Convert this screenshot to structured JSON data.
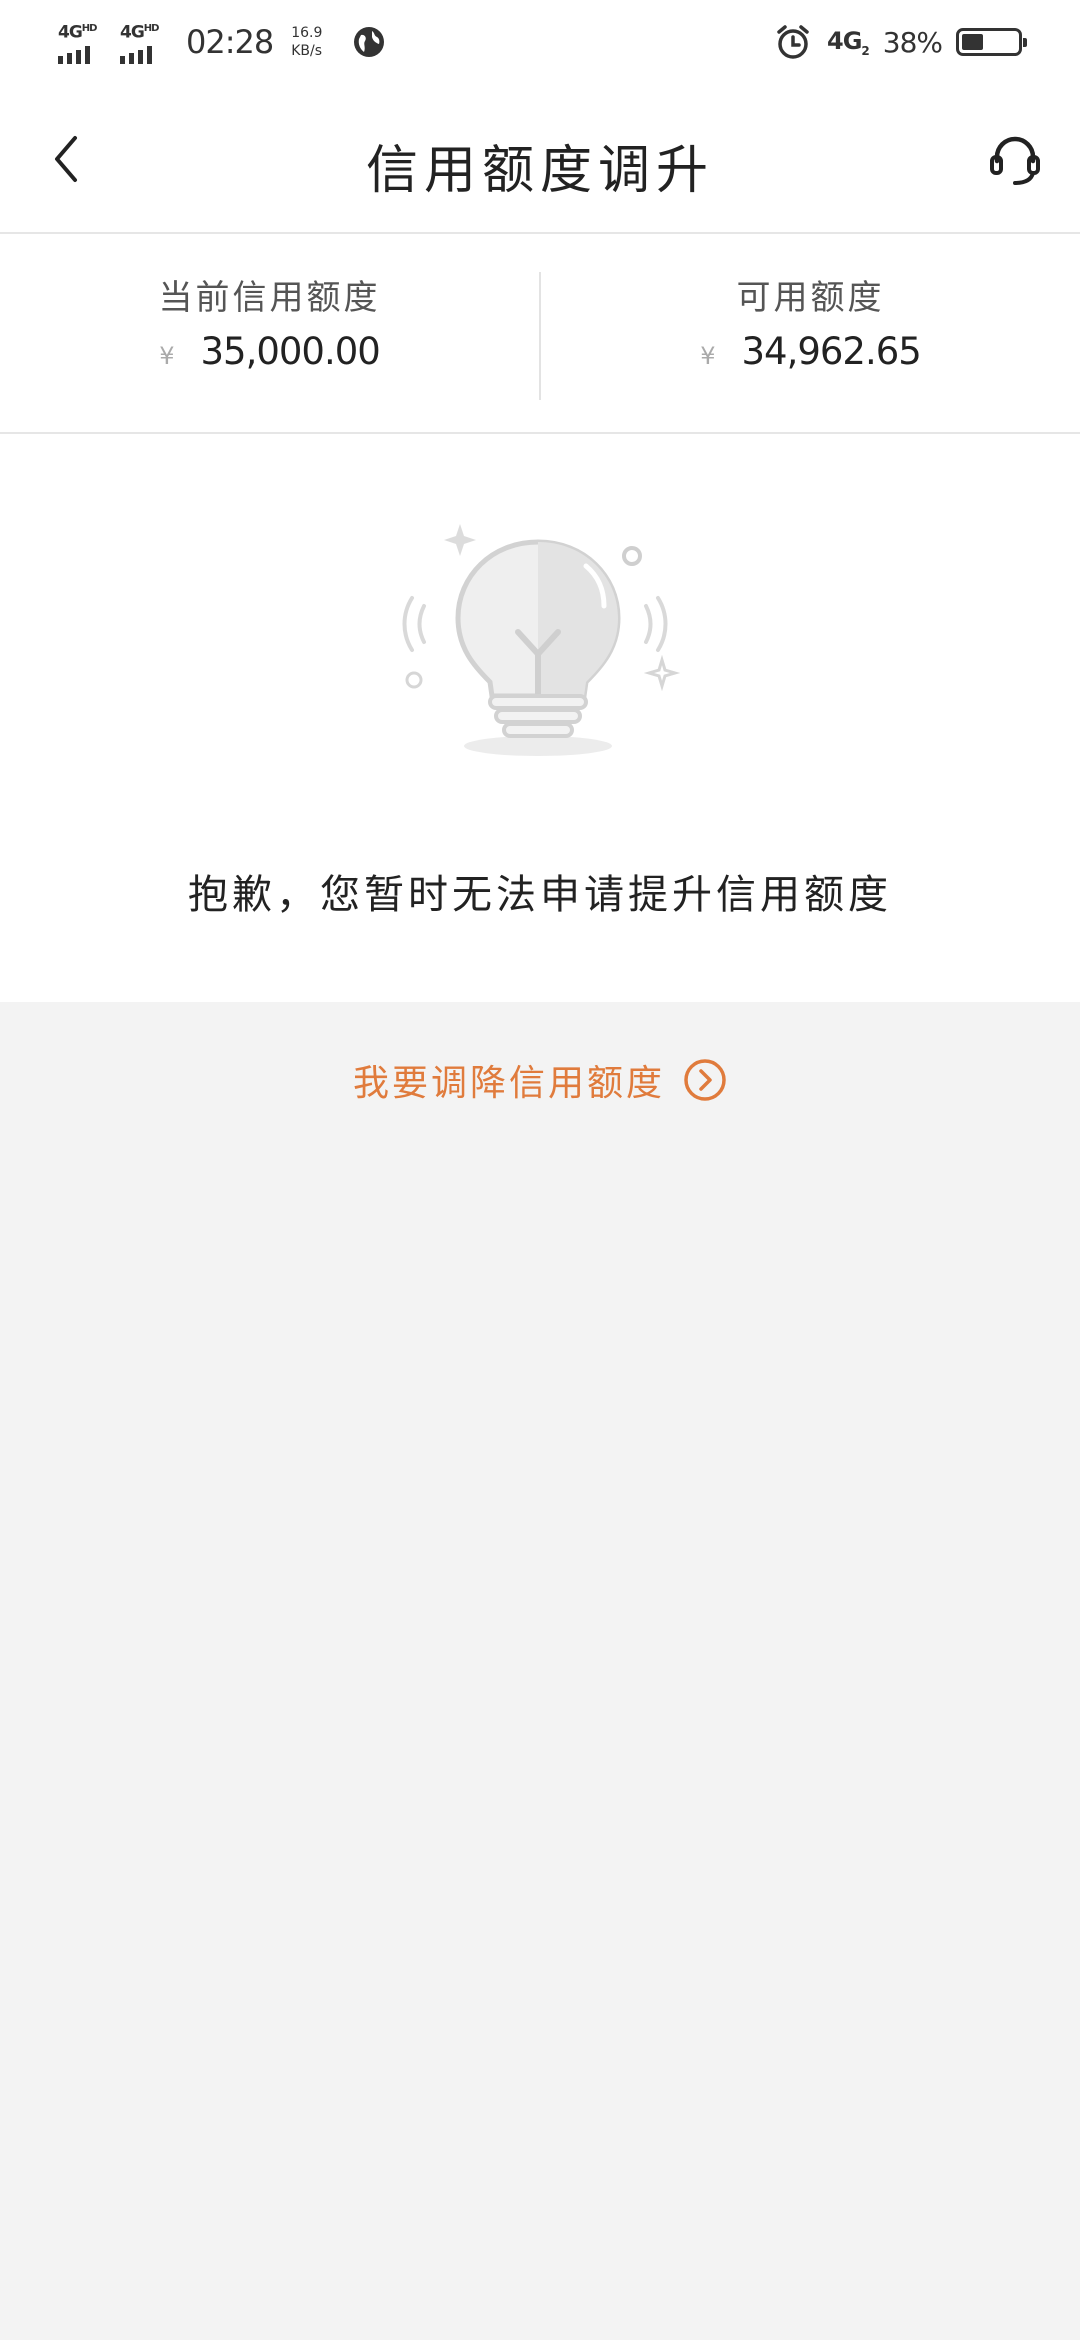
{
  "status_bar": {
    "sim1_label": "4G",
    "sim1_sup": "HD",
    "sim2_label": "4G",
    "sim2_sup": "HD",
    "time": "02:28",
    "speed_value": "16.9",
    "speed_unit": "KB/s",
    "network": "4G",
    "network_sub": "2",
    "battery_percent": "38%",
    "battery_level": 0.38
  },
  "header": {
    "title": "信用额度调升",
    "back_icon": "chevron-left-icon",
    "service_icon": "headset-icon"
  },
  "summary": {
    "current_label": "当前信用额度",
    "current_currency": "¥",
    "current_amount": "35,000.00",
    "available_label": "可用额度",
    "available_currency": "¥",
    "available_amount": "34,962.65"
  },
  "notice": {
    "icon": "lightbulb-icon",
    "message": "抱歉，您暂时无法申请提升信用额度"
  },
  "actions": {
    "lower_limit_label": "我要调降信用额度",
    "lower_limit_icon": "circle-chevron-right-icon",
    "accent_color": "#e07b3c"
  }
}
